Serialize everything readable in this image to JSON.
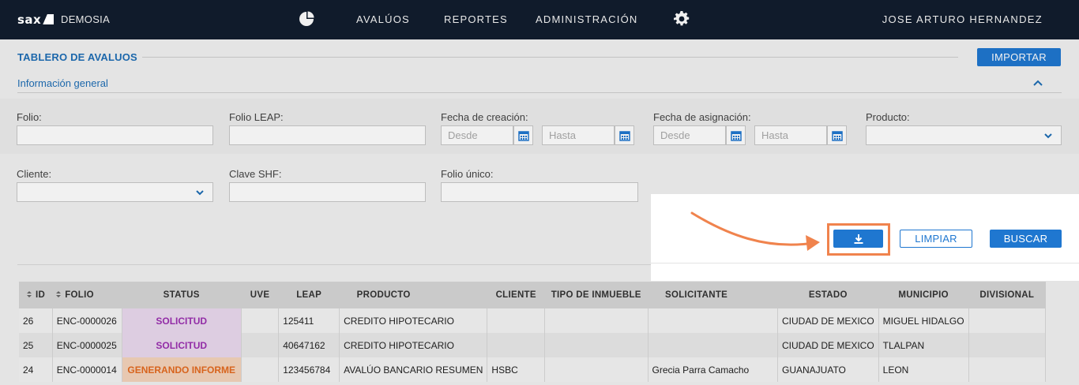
{
  "nav": {
    "logo": "sax",
    "brand": "DEMOSIA",
    "items": [
      "AVALÚOS",
      "REPORTES",
      "ADMINISTRACIÓN"
    ],
    "user": "JOSE ARTURO HERNANDEZ",
    "icons": [
      "pie-chart-icon",
      "gear-icon"
    ]
  },
  "header": {
    "title": "TABLERO DE AVALUOS",
    "import_label": "IMPORTAR",
    "section": "Información general"
  },
  "filters": {
    "folio": "Folio:",
    "folio_leap": "Folio LEAP:",
    "fecha_creacion": "Fecha de creación:",
    "fecha_asignacion": "Fecha de asignación:",
    "producto": "Producto:",
    "cliente": "Cliente:",
    "clave_shf": "Clave SHF:",
    "folio_unico": "Folio único:",
    "desde_placeholder": "Desde",
    "hasta_placeholder": "Hasta"
  },
  "actions": {
    "download_icon": "download-icon",
    "limpiar": "LIMPIAR",
    "buscar": "BUSCAR"
  },
  "colors": {
    "accent": "#1f77d0",
    "nav_bg": "#101b2b",
    "highlight": "#f0834d",
    "status_solicitud": "#9b2fb0",
    "status_generando": "#e46a1f"
  },
  "table": {
    "columns": [
      "ID",
      "FOLIO",
      "STATUS",
      "UVE",
      "LEAP",
      "PRODUCTO",
      "CLIENTE",
      "TIPO DE INMUEBLE",
      "SOLICITANTE",
      "ESTADO",
      "MUNICIPIO",
      "DIVISIONAL"
    ],
    "rows": [
      [
        "26",
        "ENC-0000026",
        "SOLICITUD",
        "",
        "125411",
        "CREDITO HIPOTECARIO",
        "",
        "",
        "",
        "CIUDAD DE MEXICO",
        "MIGUEL HIDALGO",
        ""
      ],
      [
        "25",
        "ENC-0000025",
        "SOLICITUD",
        "",
        "40647162",
        "CREDITO HIPOTECARIO",
        "",
        "",
        "",
        "CIUDAD DE MEXICO",
        "TLALPAN",
        ""
      ],
      [
        "24",
        "ENC-0000014",
        "GENERANDO INFORME",
        "",
        "123456784",
        "AVALÚO BANCARIO RESUMEN",
        "HSBC",
        "",
        "Grecia Parra Camacho",
        "GUANAJUATO",
        "LEON",
        ""
      ]
    ]
  }
}
